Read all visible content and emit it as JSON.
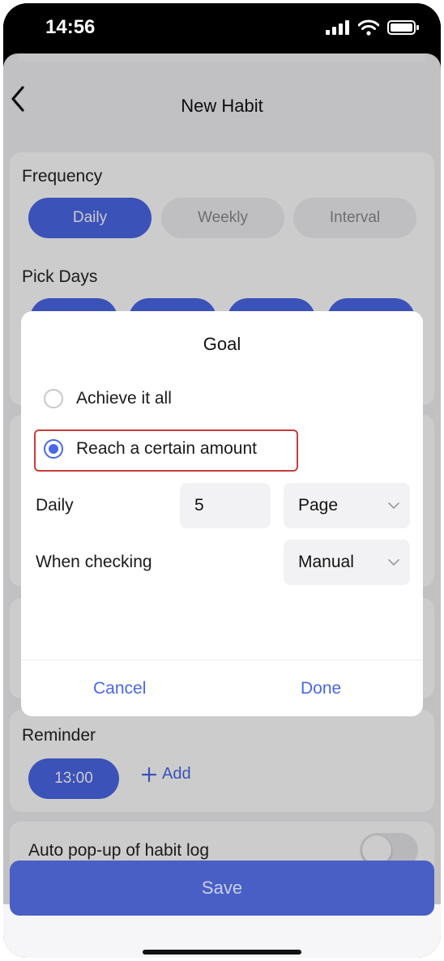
{
  "status": {
    "time": "14:56"
  },
  "nav": {
    "title": "New Habit"
  },
  "frequency": {
    "label": "Frequency",
    "options": [
      "Daily",
      "Weekly",
      "Interval"
    ],
    "selected": "Daily"
  },
  "pick_days": {
    "label": "Pick Days"
  },
  "reminder": {
    "label": "Reminder",
    "time": "13:00",
    "add_label": "Add"
  },
  "auto_popup": {
    "label": "Auto pop-up of habit log",
    "enabled": false
  },
  "save_label": "Save",
  "dialog": {
    "title": "Goal",
    "options": [
      "Achieve it all",
      "Reach a certain amount"
    ],
    "selected": "Reach a certain amount",
    "daily_label": "Daily",
    "daily_value": "5",
    "unit": "Page",
    "checking_label": "When checking",
    "checking_mode": "Manual",
    "cancel_label": "Cancel",
    "done_label": "Done"
  },
  "colors": {
    "accent": "#4a67e8",
    "highlight": "#cc3b3b"
  }
}
